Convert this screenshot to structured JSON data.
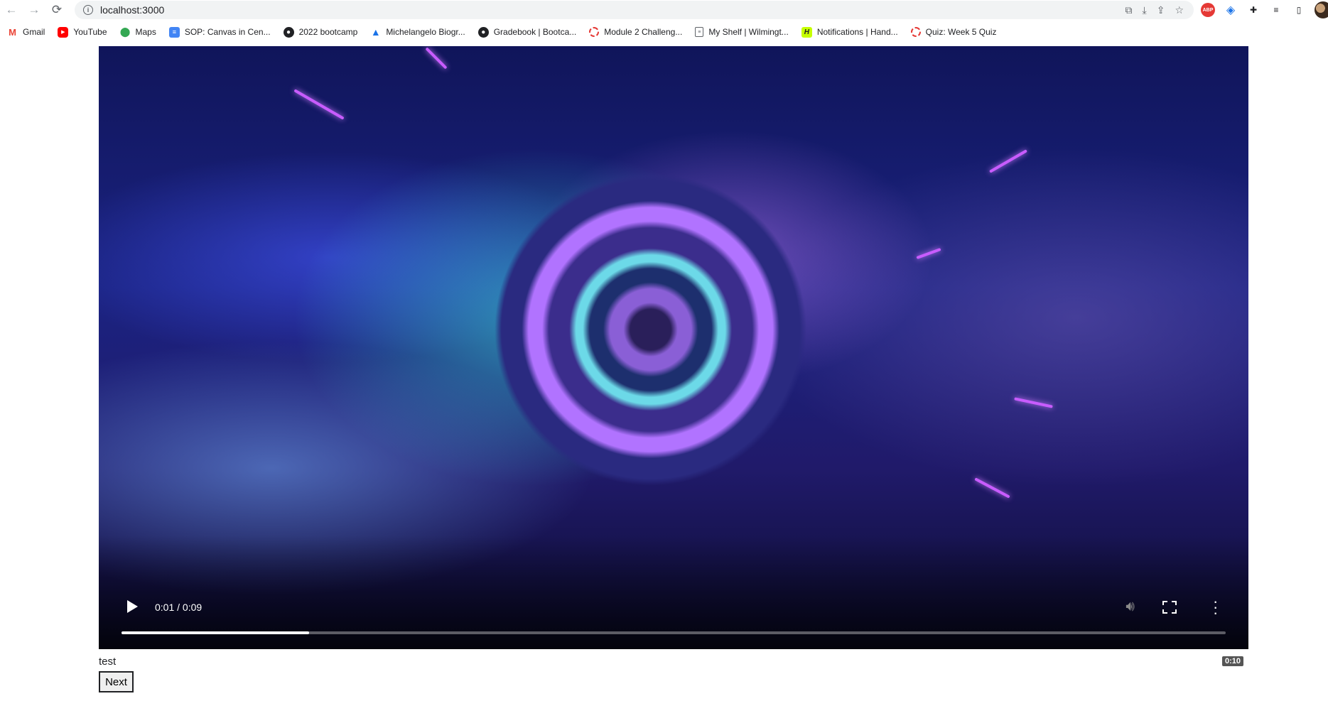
{
  "browser": {
    "url": "localhost:3000",
    "bookmarks": [
      {
        "label": "Gmail",
        "icon": "gmail-icon"
      },
      {
        "label": "YouTube",
        "icon": "youtube-icon"
      },
      {
        "label": "Maps",
        "icon": "maps-icon"
      },
      {
        "label": "SOP: Canvas in Cen...",
        "icon": "docs-icon"
      },
      {
        "label": "2022 bootcamp",
        "icon": "globe-icon"
      },
      {
        "label": "Michelangelo Biogr...",
        "icon": "triangle-icon"
      },
      {
        "label": "Gradebook | Bootca...",
        "icon": "globe-icon"
      },
      {
        "label": "Module 2 Challeng...",
        "icon": "ring-icon"
      },
      {
        "label": "My Shelf | Wilmingt...",
        "icon": "page-icon"
      },
      {
        "label": "Notifications | Hand...",
        "icon": "handshake-icon"
      },
      {
        "label": "Quiz: Week 5 Quiz",
        "icon": "ring-icon"
      }
    ]
  },
  "video": {
    "time_display": "0:01 / 0:09",
    "progress_fraction": 0.17,
    "state": "paused"
  },
  "page": {
    "caption": "test",
    "duration_badge": "0:10",
    "next_label": "Next"
  }
}
